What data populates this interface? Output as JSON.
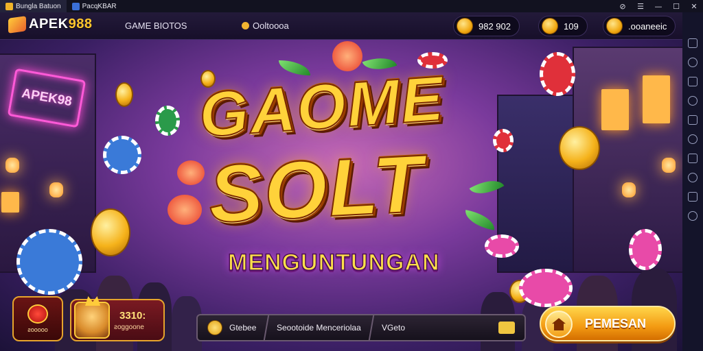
{
  "window": {
    "tab1_label": "Bungla Batuon",
    "tab2_label": "PacqKBAR",
    "btn_1": "⊘",
    "btn_2": "☰",
    "btn_minimize": "—",
    "btn_maximize": "☐",
    "btn_close": "✕"
  },
  "header": {
    "logo_text": "APEK",
    "logo_accent": "988",
    "menu_games": "GAME ВІОТОS",
    "menu_second": "Ooltoooa",
    "balance_1": "982 902",
    "balance_2": "109",
    "balance_3": ".ooaneeic"
  },
  "scene": {
    "neon_sign": "APEK98",
    "title_line1": "GAOME",
    "title_line2": "SOLT",
    "subtitle": "MENGUNTUNGAN"
  },
  "hud": {
    "gift_label": "ƨooooo",
    "profile_value": "3310:",
    "profile_sub": "ƨoggoone",
    "nav_1": "Gtebee",
    "nav_2": "Seootoide Menceriolaa",
    "nav_3": "VGeto",
    "cta_label": "PEMESAN"
  },
  "colors": {
    "accent_gold": "#ffc62e",
    "cta_orange": "#f39a12",
    "neon_pink": "#ff4ed6"
  }
}
